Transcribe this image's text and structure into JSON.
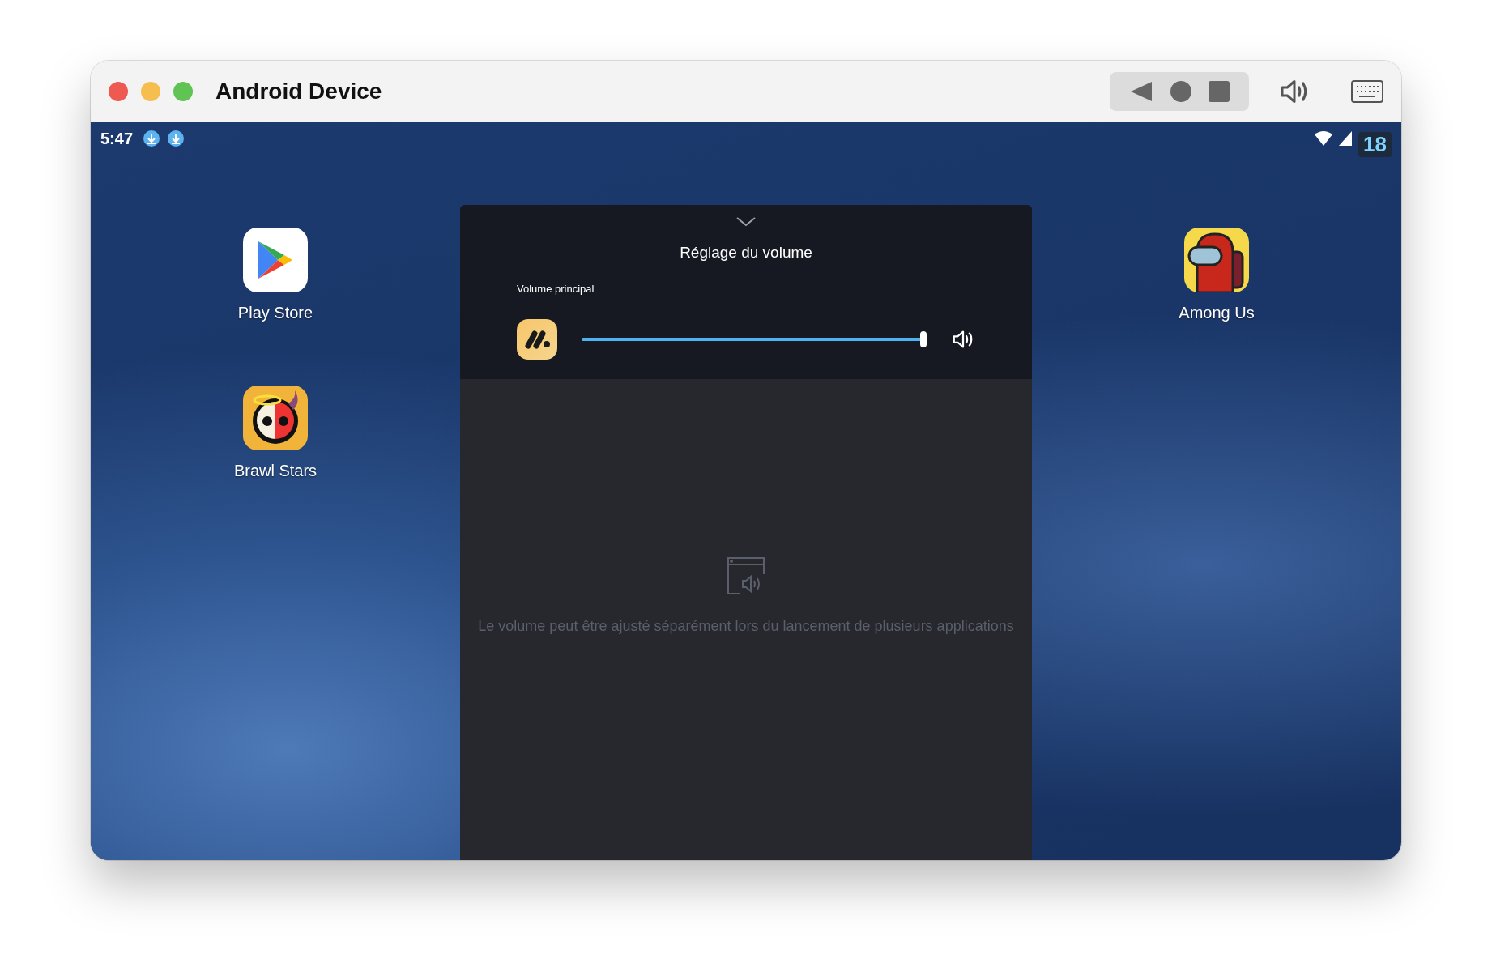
{
  "window": {
    "title": "Android Device"
  },
  "status_bar": {
    "time": "5:47",
    "notifications": [
      {
        "kind": "download"
      },
      {
        "kind": "download"
      }
    ],
    "badge": "18"
  },
  "apps_left": [
    {
      "label": "Play Store",
      "kind": "play"
    },
    {
      "label": "Brawl Stars",
      "kind": "skull"
    }
  ],
  "apps_right": [
    {
      "label": "Among Us",
      "kind": "crewmate"
    }
  ],
  "volume_panel": {
    "title": "Réglage du volume",
    "section": "Volume principal",
    "level": 1,
    "hint": "Le volume peut être ajusté séparément lors du lancement de plusieurs applications"
  }
}
